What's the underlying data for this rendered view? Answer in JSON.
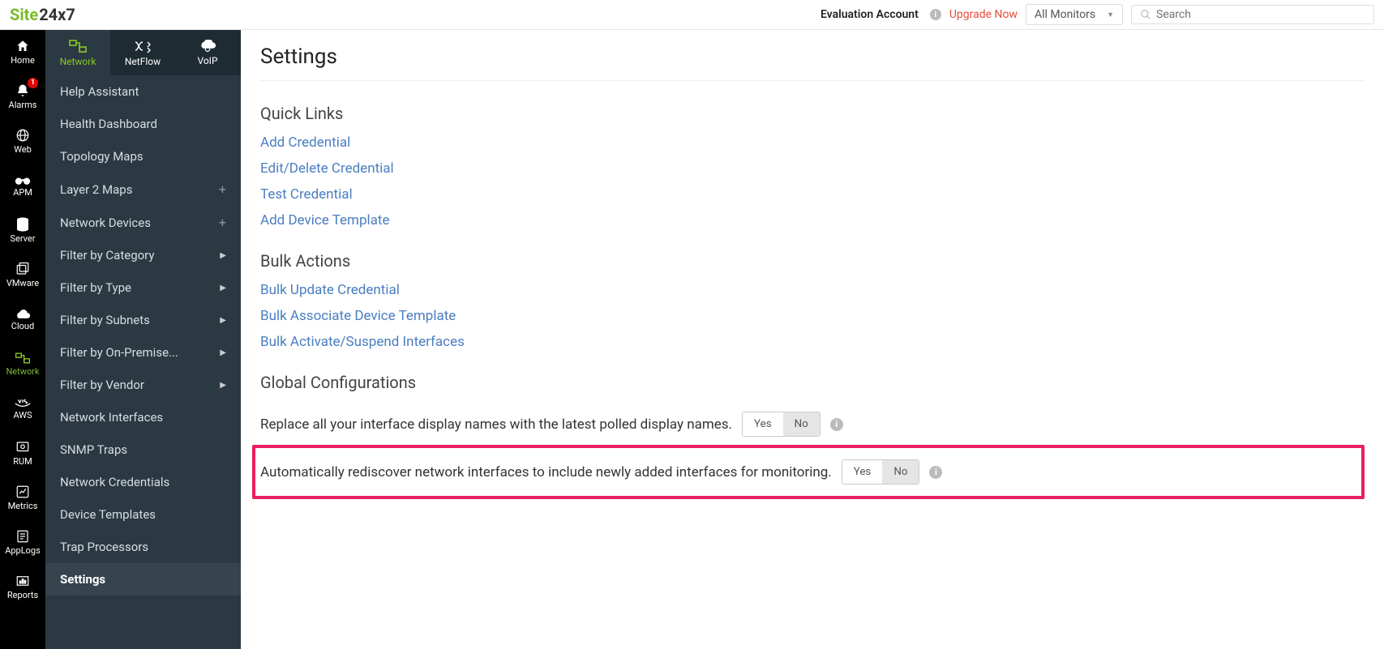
{
  "header": {
    "logo_a": "Site",
    "logo_b": "24x7",
    "eval": "Evaluation Account",
    "upgrade": "Upgrade Now",
    "monitor_select": "All Monitors",
    "search_placeholder": "Search"
  },
  "rail": {
    "items": [
      {
        "label": "Home",
        "icon": "home"
      },
      {
        "label": "Alarms",
        "icon": "bell",
        "badge": "1"
      },
      {
        "label": "Web",
        "icon": "globe"
      },
      {
        "label": "APM",
        "icon": "binoculars"
      },
      {
        "label": "Server",
        "icon": "server"
      },
      {
        "label": "VMware",
        "icon": "copy"
      },
      {
        "label": "Cloud",
        "icon": "cloud"
      },
      {
        "label": "Network",
        "icon": "network",
        "active": true
      },
      {
        "label": "AWS",
        "icon": "aws"
      },
      {
        "label": "RUM",
        "icon": "rum"
      },
      {
        "label": "Metrics",
        "icon": "metrics"
      },
      {
        "label": "AppLogs",
        "icon": "applogs"
      },
      {
        "label": "Reports",
        "icon": "reports"
      }
    ]
  },
  "subnav": {
    "items": [
      {
        "label": "Network",
        "active": true
      },
      {
        "label": "NetFlow"
      },
      {
        "label": "VoIP"
      }
    ]
  },
  "sidebar": {
    "items": [
      {
        "label": "Help Assistant"
      },
      {
        "label": "Health Dashboard"
      },
      {
        "label": "Topology Maps"
      },
      {
        "label": "Layer 2 Maps",
        "plus": true
      },
      {
        "label": "Network Devices",
        "plus": true
      },
      {
        "label": "Filter by Category",
        "caret": true
      },
      {
        "label": "Filter by Type",
        "caret": true
      },
      {
        "label": "Filter by Subnets",
        "caret": true
      },
      {
        "label": "Filter by On-Premise...",
        "caret": true
      },
      {
        "label": "Filter by Vendor",
        "caret": true
      },
      {
        "label": "Network Interfaces"
      },
      {
        "label": "SNMP Traps"
      },
      {
        "label": "Network Credentials"
      },
      {
        "label": "Device Templates"
      },
      {
        "label": "Trap Processors"
      },
      {
        "label": "Settings",
        "selected": true
      }
    ]
  },
  "main": {
    "title": "Settings",
    "quick_links": {
      "title": "Quick Links",
      "links": [
        "Add Credential",
        "Edit/Delete Credential",
        "Test Credential",
        "Add Device Template"
      ]
    },
    "bulk_actions": {
      "title": "Bulk Actions",
      "links": [
        "Bulk Update Credential",
        "Bulk Associate Device Template",
        "Bulk Activate/Suspend Interfaces"
      ]
    },
    "global": {
      "title": "Global Configurations",
      "rows": [
        {
          "text": "Replace all your interface display names with the latest polled display names.",
          "yes": "Yes",
          "no": "No",
          "selected": "no"
        },
        {
          "text": "Automatically rediscover network interfaces to include newly added interfaces for monitoring.",
          "yes": "Yes",
          "no": "No",
          "selected": "no",
          "highlight": true
        }
      ]
    }
  }
}
